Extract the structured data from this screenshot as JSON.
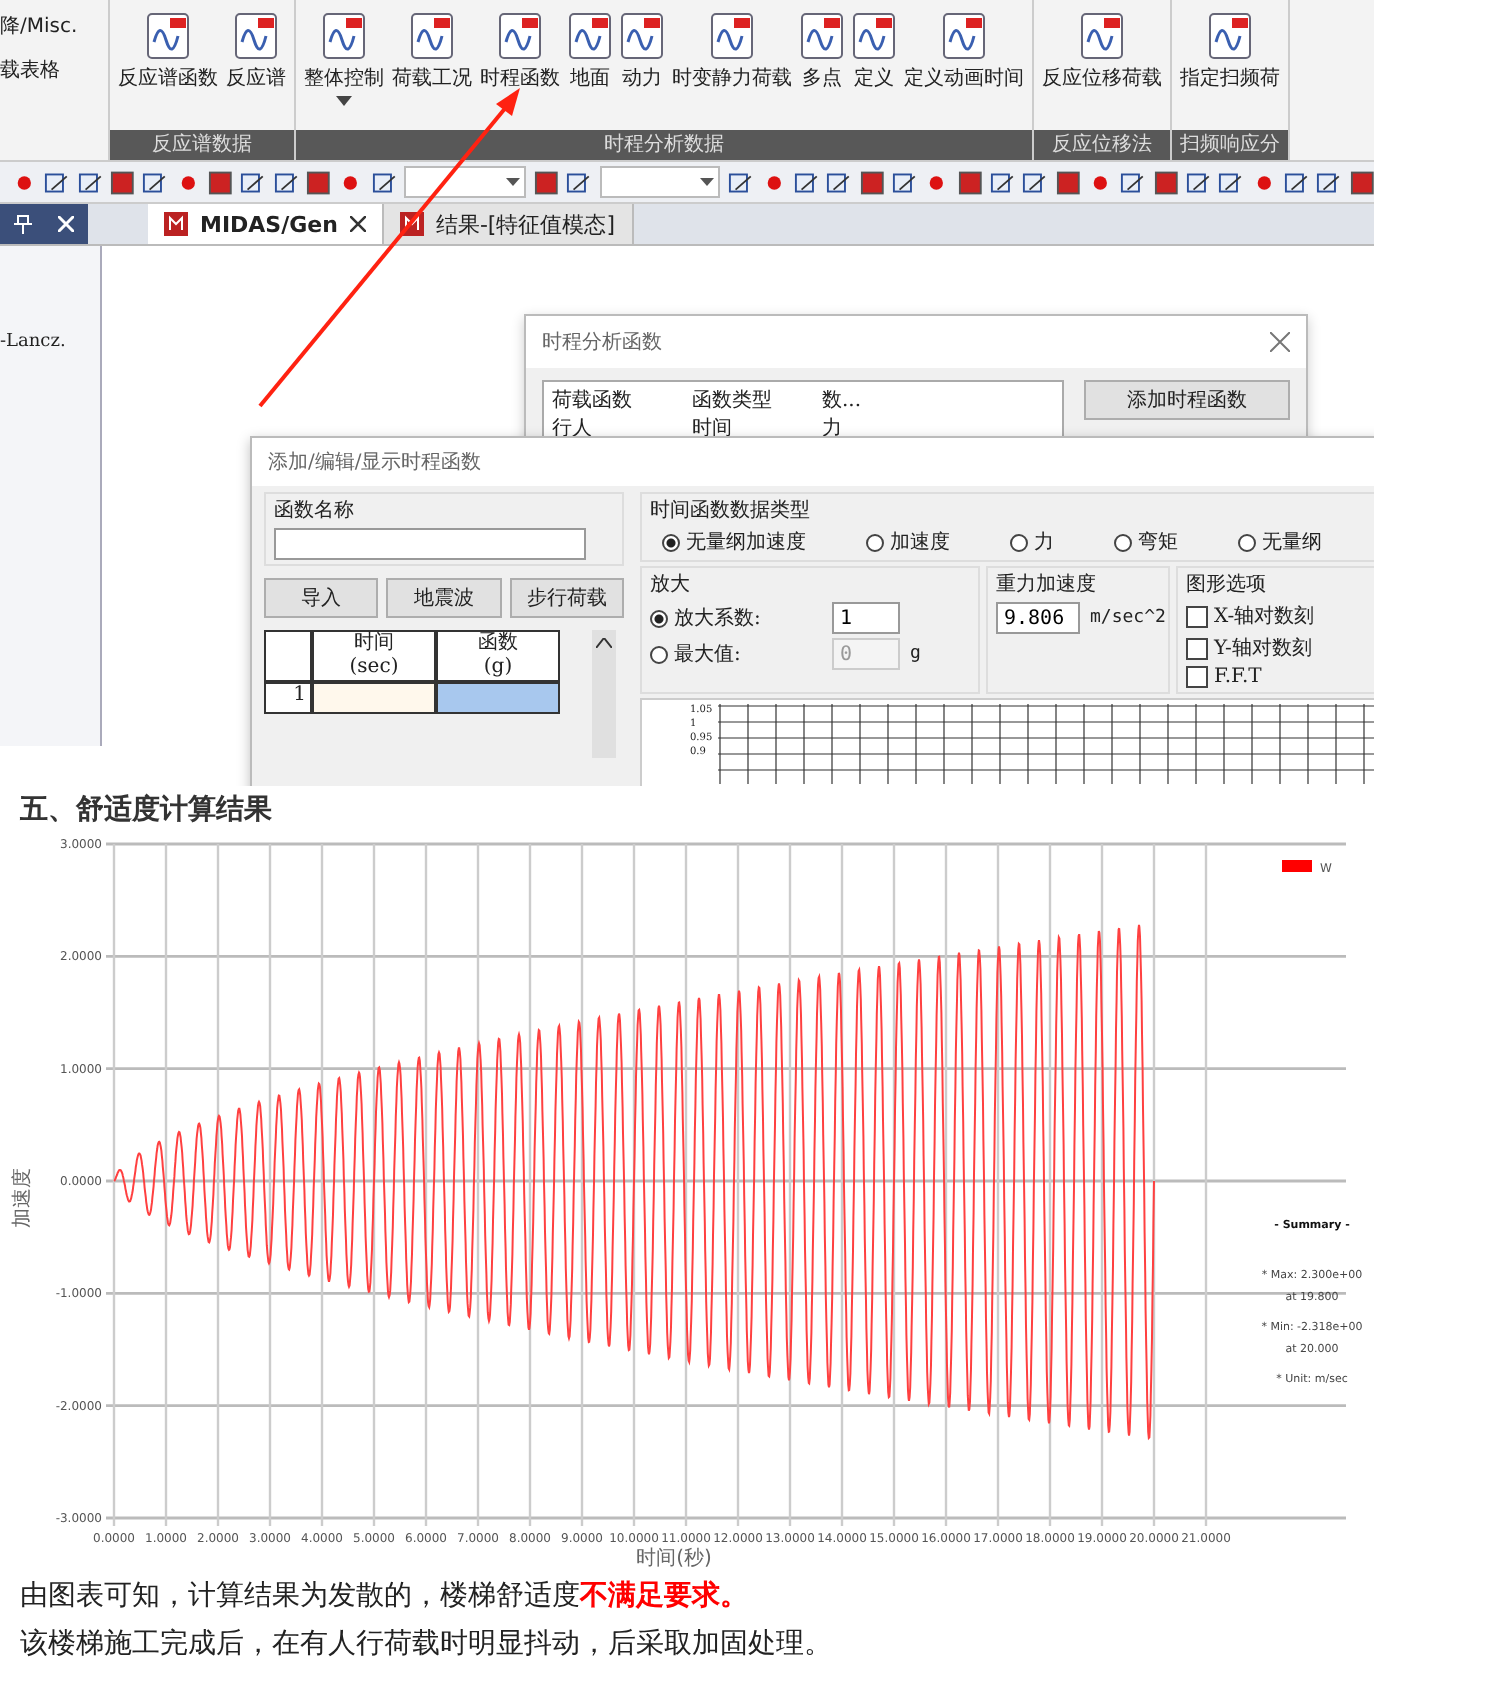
{
  "ribbon": {
    "left_labels": [
      "降/Misc.",
      "载表格"
    ],
    "groups": [
      {
        "label": "反应谱数据",
        "buttons": [
          {
            "label": "反应谱函数",
            "dropdown": false
          },
          {
            "label": "反应谱",
            "dropdown": false
          }
        ]
      },
      {
        "label": "时程分析数据",
        "buttons": [
          {
            "label": "整体控制",
            "dropdown": true
          },
          {
            "label": "荷载工况",
            "dropdown": false
          },
          {
            "label": "时程函数",
            "dropdown": false
          },
          {
            "label": "地面",
            "dropdown": false
          },
          {
            "label": "动力",
            "dropdown": false
          },
          {
            "label": "时变静力荷载",
            "dropdown": false
          },
          {
            "label": "多点",
            "dropdown": false
          },
          {
            "label": "定义",
            "dropdown": false
          },
          {
            "label": "定义动画时间",
            "dropdown": false
          }
        ]
      },
      {
        "label": "反应位移法",
        "buttons": [
          {
            "label": "反应位移荷载",
            "dropdown": false
          }
        ]
      },
      {
        "label": "扫频响应分",
        "buttons": [
          {
            "label": "指定扫频荷",
            "dropdown": false
          }
        ]
      }
    ]
  },
  "tabs": [
    {
      "label": "MIDAS/Gen",
      "selected": true
    },
    {
      "label": "结果-[特征值模态]",
      "selected": false
    }
  ],
  "side_panel": {
    "text": "-Lancz."
  },
  "function_list_dialog": {
    "title": "时程分析函数",
    "columns": [
      "荷载函数",
      "函数类型",
      "数..."
    ],
    "rows": [
      [
        "行人",
        "时间",
        "力"
      ]
    ],
    "button": "添加时程函数"
  },
  "function_dialog": {
    "title": "添加/编辑/显示时程函数",
    "name_group": "函数名称",
    "buttons": [
      "导入",
      "地震波",
      "步行荷载"
    ],
    "table": {
      "columns": [
        {
          "title": "时间",
          "unit": "(sec)"
        },
        {
          "title": "函数",
          "unit": "(g)"
        }
      ],
      "rows": [
        "1"
      ]
    },
    "type_group": "时间函数数据类型",
    "types": [
      {
        "label": "无量纲加速度",
        "selected": true
      },
      {
        "label": "加速度",
        "selected": false
      },
      {
        "label": "力",
        "selected": false
      },
      {
        "label": "弯矩",
        "selected": false
      },
      {
        "label": "无量纲",
        "selected": false
      }
    ],
    "scale_group": "放大",
    "scale_options": [
      {
        "label": "放大系数:",
        "selected": true,
        "value": "1"
      },
      {
        "label": "最大值:",
        "selected": false,
        "value": "0",
        "unit": "g"
      }
    ],
    "gravity_group": "重力加速度",
    "gravity_value": "9.806",
    "gravity_unit": "m/sec^2",
    "graph_group": "图形选项",
    "graph_options": [
      {
        "label": "X-轴对数刻",
        "checked": false
      },
      {
        "label": "Y-轴对数刻",
        "checked": false
      },
      {
        "label": "F.F.T",
        "checked": false
      }
    ],
    "preview_ticks": [
      "1.05",
      "1",
      "0.95",
      "0.9"
    ]
  },
  "heading": "五、舒适度计算结果",
  "result_chart": {
    "x_label": "时间(秒)",
    "y_label": "加速度",
    "x_tick_labels": [
      "0.0000",
      "1.0000",
      "2.0000",
      "3.0000",
      "4.0000",
      "5.0000",
      "6.0000",
      "7.0000",
      "8.0000",
      "9.0000",
      "10.0000",
      "11.0000",
      "12.0000",
      "13.0000",
      "14.0000",
      "15.0000",
      "16.0000",
      "17.0000",
      "18.0000",
      "19.0000",
      "20.0000",
      "21.0000"
    ],
    "y_tick_labels": [
      "3.0000",
      "2.0000",
      "1.0000",
      "0.0000",
      "-1.0000",
      "-2.0000",
      "-3.0000"
    ],
    "legend_label": "W",
    "summary": [
      "- Summary -",
      "* Max: 2.300e+00",
      "at 19.800",
      "* Min: -2.318e+00",
      "at 20.000",
      "* Unit: m/sec"
    ]
  },
  "paragraphs": [
    "由图表可知，计算结果为发散的，楼梯舒适度**不满足要求。**",
    "该楼梯施工完成后，在有人行荷载时明显抖动，后采取加固处理。"
  ]
}
